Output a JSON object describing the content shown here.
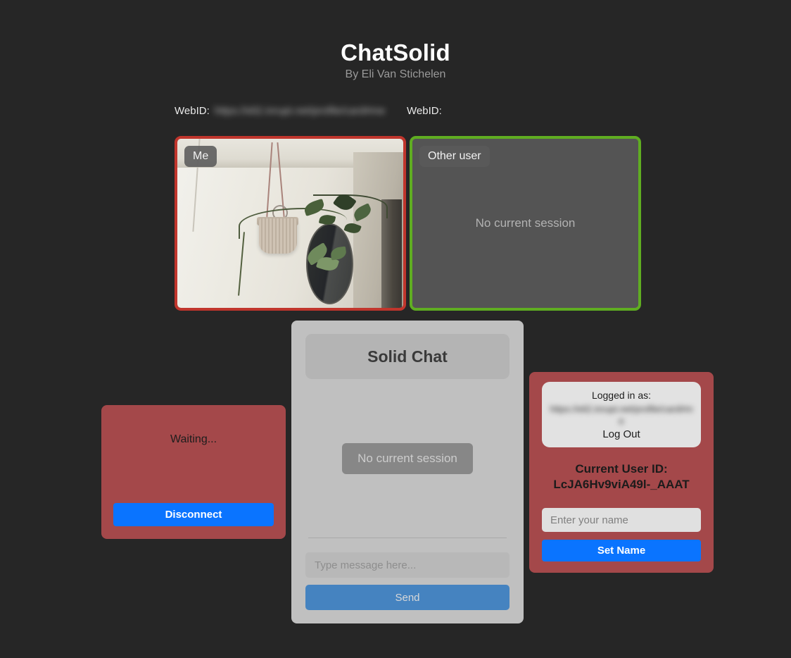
{
  "app": {
    "title": "ChatSolid",
    "subtitle": "By Eli Van Stichelen",
    "background_color": "#262626"
  },
  "webid_row": {
    "self": {
      "label": "WebID:",
      "value": "https://eli2.inrupt.net/profile/card#me",
      "redacted": true
    },
    "peer": {
      "label": "WebID:",
      "value": "",
      "redacted": false
    }
  },
  "videos": {
    "self": {
      "tag": "Me",
      "border_color": "#c0352c",
      "has_stream": true,
      "placeholder": ""
    },
    "peer": {
      "tag": "Other user",
      "border_color": "#5fad21",
      "has_stream": false,
      "placeholder": "No current session"
    }
  },
  "chat": {
    "header_title": "Solid Chat",
    "status_badge": "No current session",
    "input_placeholder": "Type message here...",
    "input_value": "",
    "send_label": "Send",
    "send_color": "#4583c0",
    "messages": []
  },
  "connection": {
    "status": "Waiting...",
    "disconnect_label": "Disconnect",
    "panel_color": "#a4484a",
    "button_color": "#0a74ff"
  },
  "account": {
    "logged_in_label": "Logged in as:",
    "webid": "https://eli2.inrupt.net/profile/card#me",
    "logout_label": "Log Out",
    "user_id_label": "Current User ID:",
    "user_id_value": "LcJA6Hv9viA49l-_AAAT",
    "name_placeholder": "Enter your name",
    "name_value": "",
    "set_name_label": "Set Name",
    "panel_color": "#a4484a",
    "button_color": "#0a74ff"
  }
}
